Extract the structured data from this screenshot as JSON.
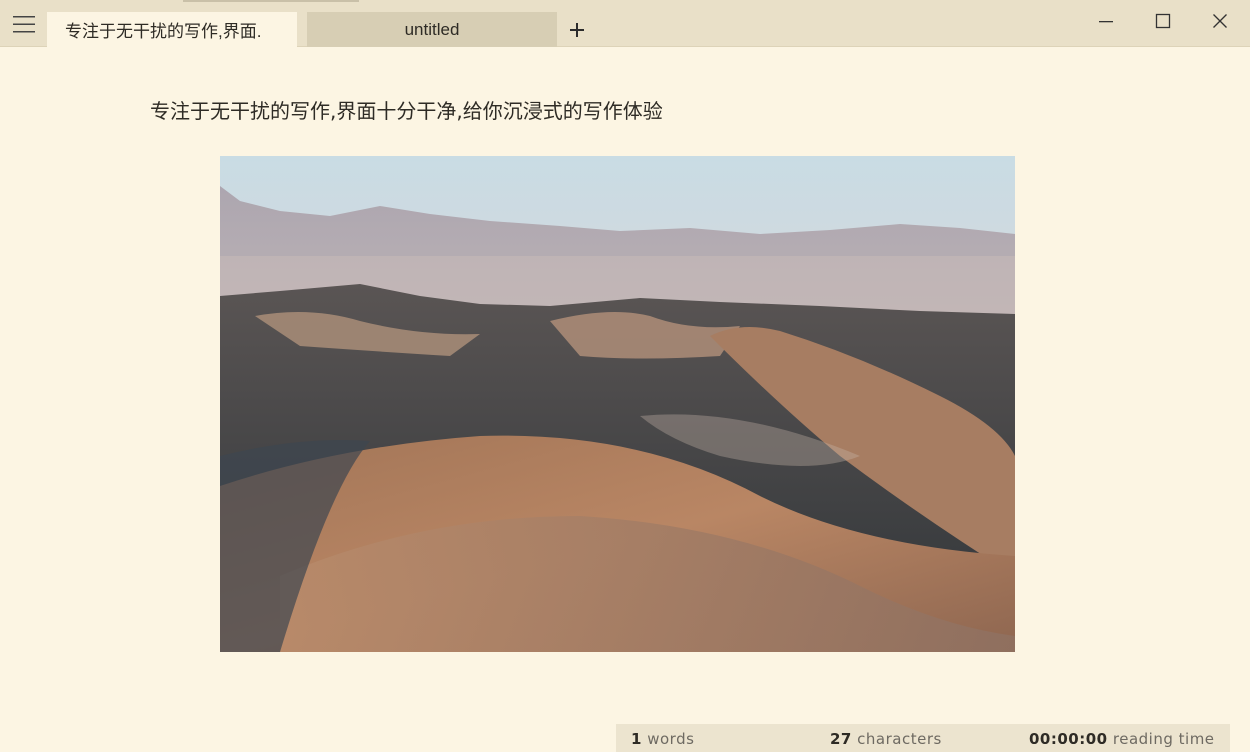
{
  "app": {
    "menu_icon": "hamburger-icon",
    "tabs": [
      {
        "label": "专注于无干扰的写作,界面.",
        "active": true,
        "unsaved": true
      },
      {
        "label": "untitled",
        "active": false,
        "unsaved": false
      }
    ],
    "add_tab_icon": "plus-icon",
    "window_controls": [
      "minimize-icon",
      "maximize-icon",
      "close-icon"
    ]
  },
  "editor": {
    "text": "专注于无干扰的写作,界面十分干净,给你沉浸式的写作体验",
    "image_subject": "desert-dunes-photo"
  },
  "status": {
    "words_count": "1",
    "words_label": "words",
    "characters_count": "27",
    "characters_label": "characters",
    "reading_time": "00:00:00",
    "reading_time_label": "reading time"
  },
  "colors": {
    "background": "#fcf5e3",
    "titlebar": "#e9e0c8",
    "inactive_tab": "#d7ceb4",
    "status_bar": "#ece4cf"
  }
}
